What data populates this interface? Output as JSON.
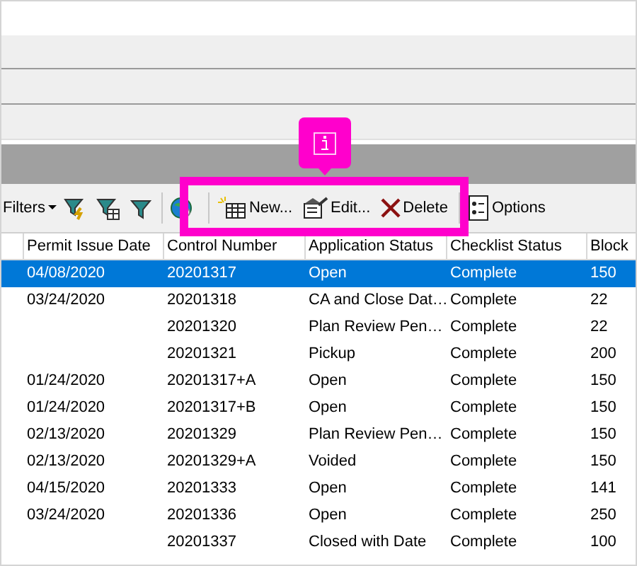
{
  "toolbar": {
    "filters_label": "Filters",
    "buttons": [
      {
        "label": "New...",
        "kind": "new"
      },
      {
        "label": "Edit...",
        "kind": "edit"
      },
      {
        "label": "Delete",
        "kind": "delete"
      },
      {
        "label": "Options",
        "kind": "options"
      }
    ]
  },
  "callout": {
    "kind": "info"
  },
  "table": {
    "columns": [
      "Permit Issue Date",
      "Control Number",
      "Application Status",
      "Checklist Status",
      "Block"
    ],
    "rows": [
      {
        "cells": [
          "04/08/2020",
          "20201317",
          "Open",
          "Complete",
          "150"
        ],
        "selected": true
      },
      {
        "cells": [
          "03/24/2020",
          "20201318",
          "CA and Close Dat…",
          "Complete",
          "22"
        ],
        "selected": false
      },
      {
        "cells": [
          "",
          "20201320",
          "Plan Review Pen…",
          "Complete",
          "22"
        ],
        "selected": false
      },
      {
        "cells": [
          "",
          "20201321",
          "Pickup",
          "Complete",
          "200"
        ],
        "selected": false
      },
      {
        "cells": [
          "01/24/2020",
          "20201317+A",
          "Open",
          "Complete",
          "150"
        ],
        "selected": false
      },
      {
        "cells": [
          "01/24/2020",
          "20201317+B",
          "Open",
          "Complete",
          "150"
        ],
        "selected": false
      },
      {
        "cells": [
          "02/13/2020",
          "20201329",
          "Plan Review Pen…",
          "Complete",
          "150"
        ],
        "selected": false
      },
      {
        "cells": [
          "02/13/2020",
          "20201329+A",
          "Voided",
          "Complete",
          "150"
        ],
        "selected": false
      },
      {
        "cells": [
          "04/15/2020",
          "20201333",
          "Open",
          "Complete",
          "141"
        ],
        "selected": false
      },
      {
        "cells": [
          "03/24/2020",
          "20201336",
          "Open",
          "Complete",
          "250"
        ],
        "selected": false
      },
      {
        "cells": [
          "",
          "20201337",
          "Closed with Date",
          "Complete",
          "100"
        ],
        "selected": false
      }
    ]
  }
}
